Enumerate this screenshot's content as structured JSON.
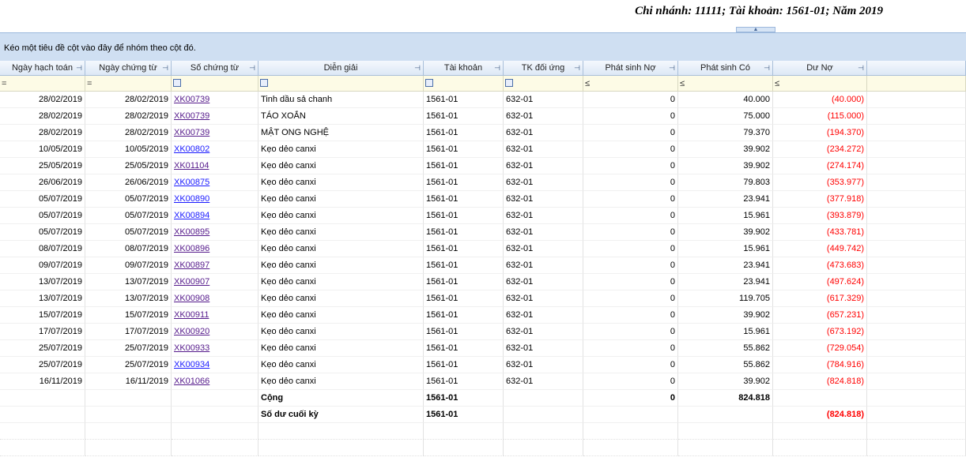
{
  "report_title": "Chi nhánh: 11111; Tài khoản: 1561-01; Năm 2019",
  "group_hint": "Kéo một tiêu đề cột vào đây để nhóm theo cột đó.",
  "columns": [
    "Ngày hạch toán",
    "Ngày chứng từ",
    "Số chứng từ",
    "Diễn giải",
    "Tài khoản",
    "TK đối ứng",
    "Phát sinh Nợ",
    "Phát sinh Có",
    "Dư Nợ"
  ],
  "filter_ops": [
    "=",
    "=",
    "",
    "",
    "",
    "",
    "≤",
    "≤",
    "≤"
  ],
  "rows": [
    {
      "date": "28/02/2019",
      "doc_date": "28/02/2019",
      "doc_no": "XK00739",
      "desc": "Tinh dầu sả chanh",
      "account": "1561-01",
      "contra": "632-01",
      "debit": "0",
      "credit": "40.000",
      "balance": "(40.000)"
    },
    {
      "date": "28/02/2019",
      "doc_date": "28/02/2019",
      "doc_no": "XK00739",
      "desc": "TÁO XOẮN",
      "account": "1561-01",
      "contra": "632-01",
      "debit": "0",
      "credit": "75.000",
      "balance": "(115.000)"
    },
    {
      "date": "28/02/2019",
      "doc_date": "28/02/2019",
      "doc_no": "XK00739",
      "desc": "MẬT ONG NGHỆ",
      "account": "1561-01",
      "contra": "632-01",
      "debit": "0",
      "credit": "79.370",
      "balance": "(194.370)"
    },
    {
      "date": "10/05/2019",
      "doc_date": "10/05/2019",
      "doc_no": "XK00802",
      "desc": "Kẹo dẻo canxi",
      "account": "1561-01",
      "contra": "632-01",
      "debit": "0",
      "credit": "39.902",
      "balance": "(234.272)"
    },
    {
      "date": "25/05/2019",
      "doc_date": "25/05/2019",
      "doc_no": "XK01104",
      "desc": "Kẹo dẻo canxi",
      "account": "1561-01",
      "contra": "632-01",
      "debit": "0",
      "credit": "39.902",
      "balance": "(274.174)"
    },
    {
      "date": "26/06/2019",
      "doc_date": "26/06/2019",
      "doc_no": "XK00875",
      "desc": "Kẹo dẻo canxi",
      "account": "1561-01",
      "contra": "632-01",
      "debit": "0",
      "credit": "79.803",
      "balance": "(353.977)"
    },
    {
      "date": "05/07/2019",
      "doc_date": "05/07/2019",
      "doc_no": "XK00890",
      "desc": "Kẹo dẻo canxi",
      "account": "1561-01",
      "contra": "632-01",
      "debit": "0",
      "credit": "23.941",
      "balance": "(377.918)"
    },
    {
      "date": "05/07/2019",
      "doc_date": "05/07/2019",
      "doc_no": "XK00894",
      "desc": "Kẹo dẻo canxi",
      "account": "1561-01",
      "contra": "632-01",
      "debit": "0",
      "credit": "15.961",
      "balance": "(393.879)"
    },
    {
      "date": "05/07/2019",
      "doc_date": "05/07/2019",
      "doc_no": "XK00895",
      "desc": "Kẹo dẻo canxi",
      "account": "1561-01",
      "contra": "632-01",
      "debit": "0",
      "credit": "39.902",
      "balance": "(433.781)"
    },
    {
      "date": "08/07/2019",
      "doc_date": "08/07/2019",
      "doc_no": "XK00896",
      "desc": "Kẹo dẻo canxi",
      "account": "1561-01",
      "contra": "632-01",
      "debit": "0",
      "credit": "15.961",
      "balance": "(449.742)"
    },
    {
      "date": "09/07/2019",
      "doc_date": "09/07/2019",
      "doc_no": "XK00897",
      "desc": "Kẹo dẻo canxi",
      "account": "1561-01",
      "contra": "632-01",
      "debit": "0",
      "credit": "23.941",
      "balance": "(473.683)"
    },
    {
      "date": "13/07/2019",
      "doc_date": "13/07/2019",
      "doc_no": "XK00907",
      "desc": "Kẹo dẻo canxi",
      "account": "1561-01",
      "contra": "632-01",
      "debit": "0",
      "credit": "23.941",
      "balance": "(497.624)"
    },
    {
      "date": "13/07/2019",
      "doc_date": "13/07/2019",
      "doc_no": "XK00908",
      "desc": "Kẹo dẻo canxi",
      "account": "1561-01",
      "contra": "632-01",
      "debit": "0",
      "credit": "119.705",
      "balance": "(617.329)"
    },
    {
      "date": "15/07/2019",
      "doc_date": "15/07/2019",
      "doc_no": "XK00911",
      "desc": "Kẹo dẻo canxi",
      "account": "1561-01",
      "contra": "632-01",
      "debit": "0",
      "credit": "39.902",
      "balance": "(657.231)"
    },
    {
      "date": "17/07/2019",
      "doc_date": "17/07/2019",
      "doc_no": "XK00920",
      "desc": "Kẹo dẻo canxi",
      "account": "1561-01",
      "contra": "632-01",
      "debit": "0",
      "credit": "15.961",
      "balance": "(673.192)"
    },
    {
      "date": "25/07/2019",
      "doc_date": "25/07/2019",
      "doc_no": "XK00933",
      "desc": "Kẹo dẻo canxi",
      "account": "1561-01",
      "contra": "632-01",
      "debit": "0",
      "credit": "55.862",
      "balance": "(729.054)"
    },
    {
      "date": "25/07/2019",
      "doc_date": "25/07/2019",
      "doc_no": "XK00934",
      "desc": "Kẹo dẻo canxi",
      "account": "1561-01",
      "contra": "632-01",
      "debit": "0",
      "credit": "55.862",
      "balance": "(784.916)"
    },
    {
      "date": "16/11/2019",
      "doc_date": "16/11/2019",
      "doc_no": "XK01066",
      "desc": "Kẹo dẻo canxi",
      "account": "1561-01",
      "contra": "632-01",
      "debit": "0",
      "credit": "39.902",
      "balance": "(824.818)"
    }
  ],
  "visited_links": [
    "XK00739",
    "XK01104",
    "XK00895",
    "XK00896",
    "XK00897",
    "XK00907",
    "XK00908",
    "XK00911",
    "XK00920",
    "XK00933",
    "XK01066"
  ],
  "total": {
    "label": "Cộng",
    "account": "1561-01",
    "debit": "0",
    "credit": "824.818"
  },
  "closing": {
    "label": "Số dư cuối kỳ",
    "account": "1561-01",
    "balance": "(824.818)"
  },
  "colors": {
    "header_bg": "#dde8f6",
    "group_bar": "#cfdff2",
    "filter_bg": "#fdfbe6",
    "negative": "#ff0000",
    "link_visited": "#551a8b",
    "link": "#1a1aff"
  }
}
